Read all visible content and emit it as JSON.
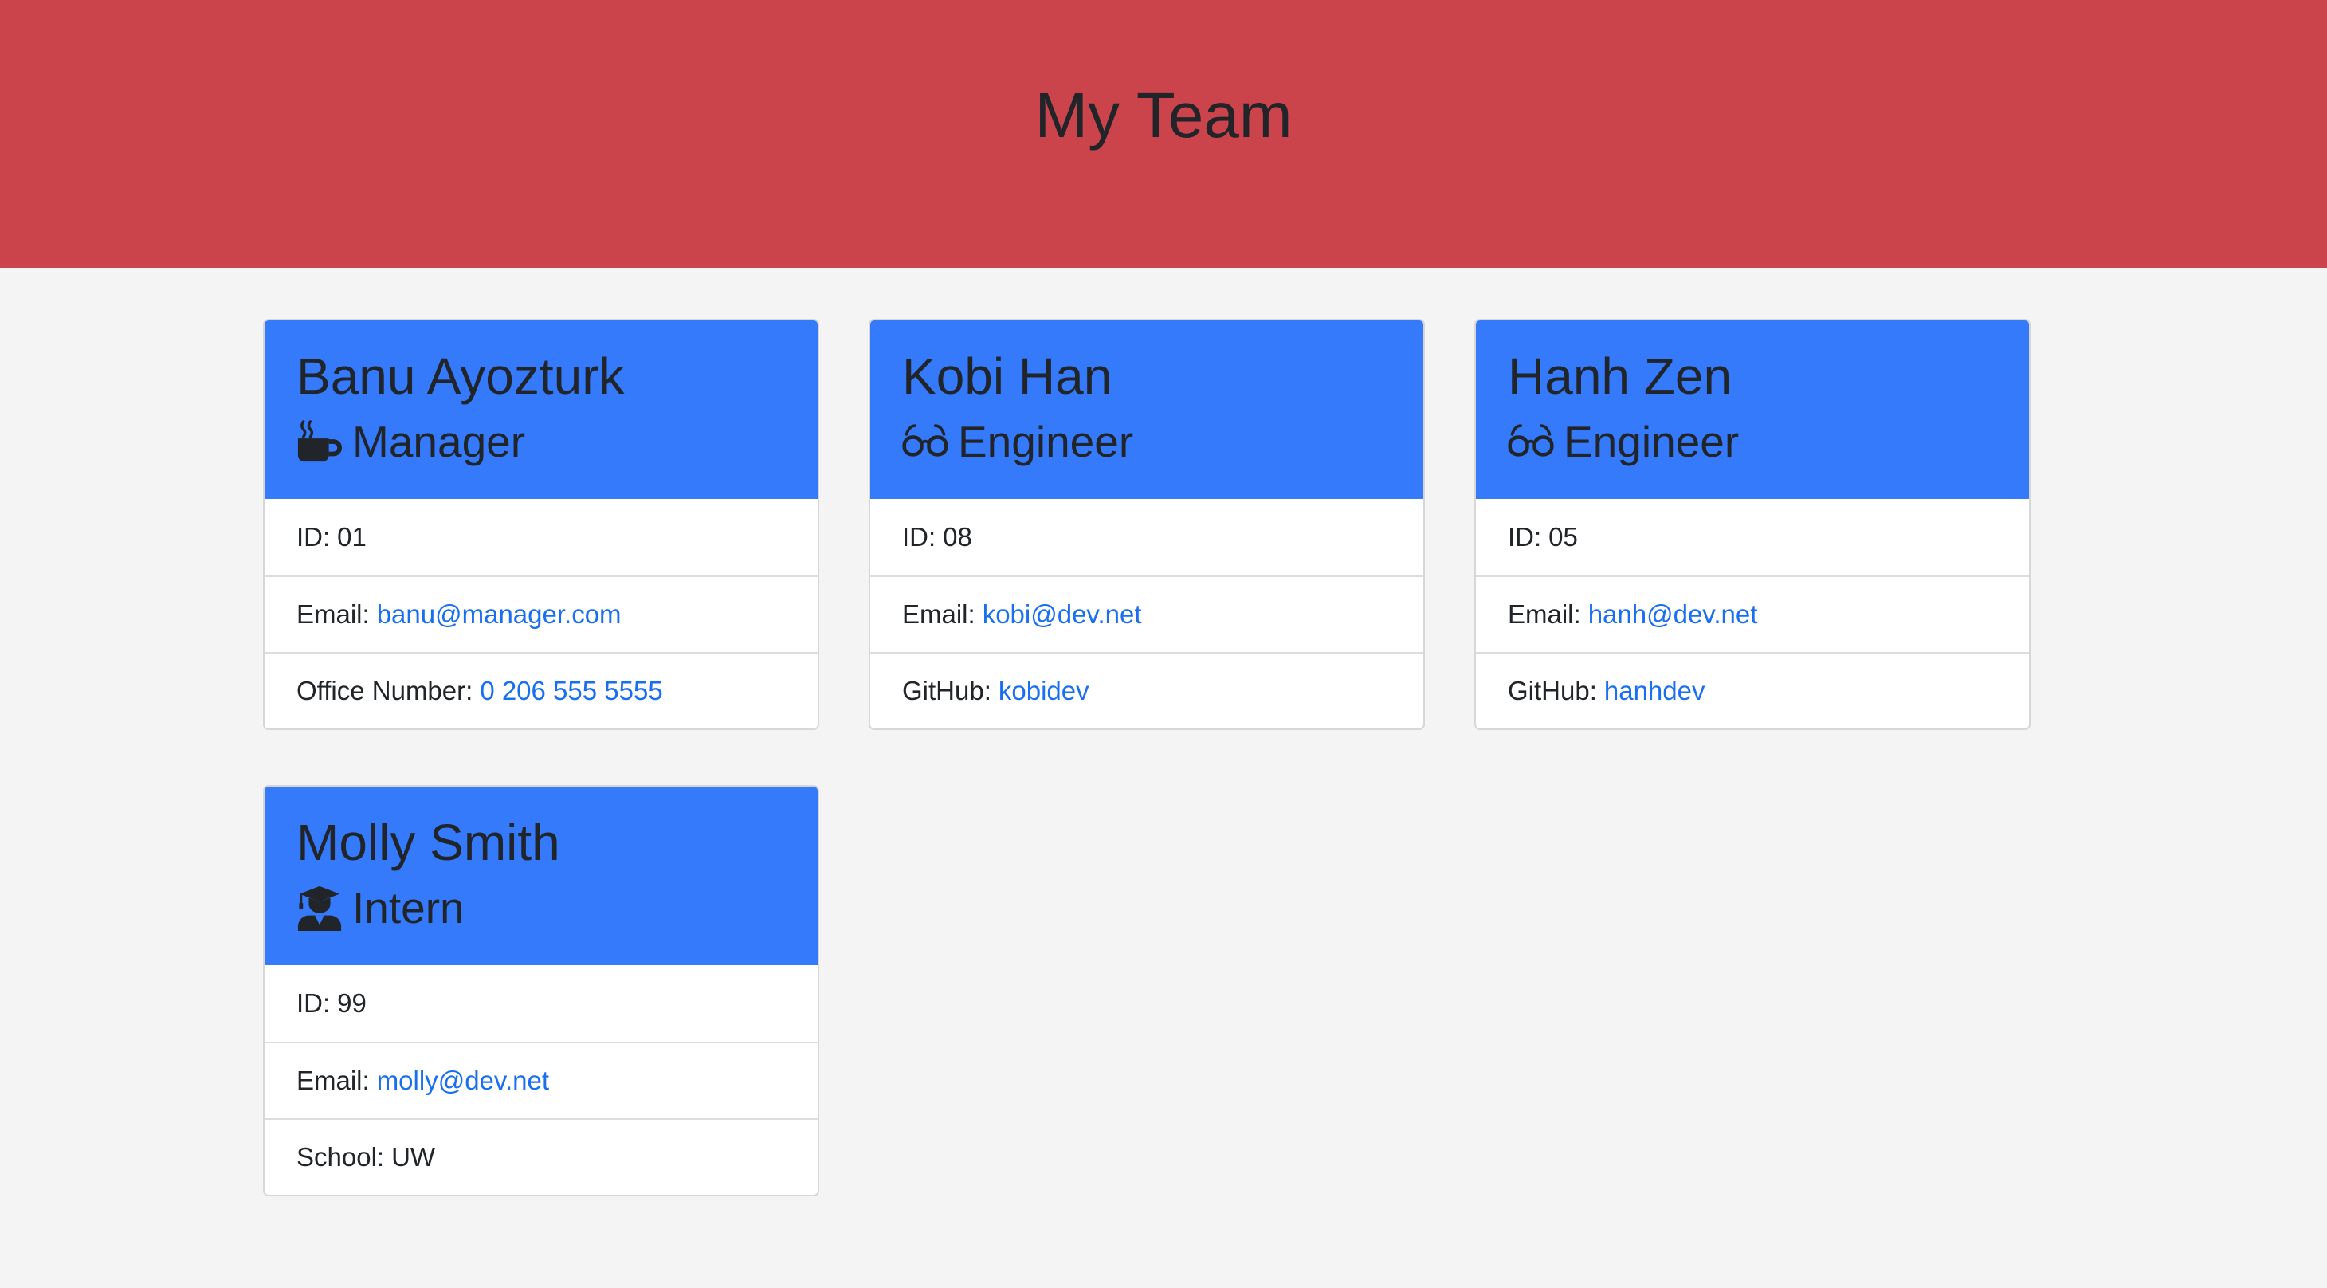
{
  "header": {
    "title": "My Team"
  },
  "colors": {
    "banner": "#cc444b",
    "card_header": "#347afa",
    "link": "#1a6ef0",
    "background": "#f4f4f4"
  },
  "cards": [
    {
      "name": "Banu Ayozturk",
      "role": "Manager",
      "role_icon": "coffee-mug-icon",
      "id_label": "ID:",
      "id_value": "01",
      "email_label": "Email:",
      "email_value": "banu@manager.com",
      "extra_label": "Office Number:",
      "extra_value": "0 206 555 5555"
    },
    {
      "name": "Kobi Han",
      "role": "Engineer",
      "role_icon": "glasses-icon",
      "id_label": "ID:",
      "id_value": "08",
      "email_label": "Email:",
      "email_value": "kobi@dev.net",
      "extra_label": "GitHub:",
      "extra_value": "kobidev"
    },
    {
      "name": "Hanh Zen",
      "role": "Engineer",
      "role_icon": "glasses-icon",
      "id_label": "ID:",
      "id_value": "05",
      "email_label": "Email:",
      "email_value": "hanh@dev.net",
      "extra_label": "GitHub:",
      "extra_value": "hanhdev"
    },
    {
      "name": "Molly Smith",
      "role": "Intern",
      "role_icon": "graduate-icon",
      "id_label": "ID:",
      "id_value": "99",
      "email_label": "Email:",
      "email_value": "molly@dev.net",
      "extra_label": "School:",
      "extra_value": "UW"
    }
  ]
}
